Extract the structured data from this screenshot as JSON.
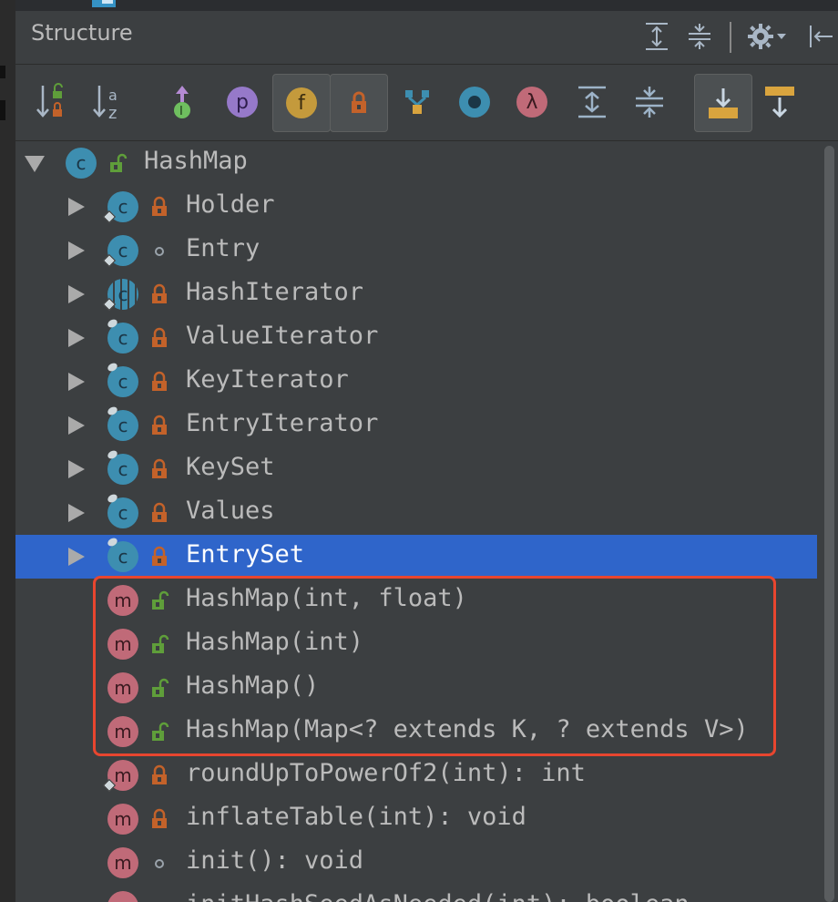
{
  "panel": {
    "title": "Structure"
  },
  "header_buttons": [
    {
      "name": "expand-all-icon"
    },
    {
      "name": "collapse-all-icon"
    },
    {
      "name": "gear-icon"
    },
    {
      "name": "hide-panel-icon"
    }
  ],
  "toolbar": [
    {
      "name": "sort-by-visibility-icon",
      "active": false
    },
    {
      "name": "sort-alphabetically-icon",
      "active": false
    },
    {
      "name": "show-inherited-icon",
      "active": false
    },
    {
      "name": "show-properties-icon",
      "glyph": "p",
      "active": false
    },
    {
      "name": "show-fields-icon",
      "glyph": "f",
      "active": true
    },
    {
      "name": "show-non-public-icon",
      "active": true
    },
    {
      "name": "show-hierarchy-icon",
      "active": false
    },
    {
      "name": "show-anonymous-icon",
      "active": false
    },
    {
      "name": "show-lambdas-icon",
      "glyph": "λ",
      "active": false
    },
    {
      "name": "expand-icon",
      "active": false
    },
    {
      "name": "collapse-icon",
      "active": false
    },
    {
      "name": "autoscroll-to-source-icon",
      "active": true
    },
    {
      "name": "autoscroll-from-source-icon",
      "active": false
    }
  ],
  "tree": [
    {
      "label": "HashMap",
      "kind": "class",
      "visibility": "public",
      "depth": 0,
      "expanded": true
    },
    {
      "label": "Holder",
      "kind": "class",
      "visibility": "private",
      "depth": 1,
      "expanded": false
    },
    {
      "label": "Entry",
      "kind": "class",
      "visibility": "package",
      "depth": 1,
      "expanded": false
    },
    {
      "label": "HashIterator",
      "kind": "abstract-class",
      "visibility": "private",
      "depth": 1,
      "expanded": false
    },
    {
      "label": "ValueIterator",
      "kind": "class",
      "visibility": "private",
      "depth": 1,
      "expanded": false
    },
    {
      "label": "KeyIterator",
      "kind": "class",
      "visibility": "private",
      "depth": 1,
      "expanded": false
    },
    {
      "label": "EntryIterator",
      "kind": "class",
      "visibility": "private",
      "depth": 1,
      "expanded": false
    },
    {
      "label": "KeySet",
      "kind": "class",
      "visibility": "private",
      "depth": 1,
      "expanded": false
    },
    {
      "label": "Values",
      "kind": "class",
      "visibility": "private",
      "depth": 1,
      "expanded": false
    },
    {
      "label": "EntrySet",
      "kind": "class",
      "visibility": "private",
      "depth": 1,
      "expanded": false,
      "selected": true
    },
    {
      "label": "HashMap(int, float)",
      "kind": "method",
      "visibility": "public",
      "depth": 1
    },
    {
      "label": "HashMap(int)",
      "kind": "method",
      "visibility": "public",
      "depth": 1
    },
    {
      "label": "HashMap()",
      "kind": "method",
      "visibility": "public",
      "depth": 1
    },
    {
      "label": "HashMap(Map<? extends K, ? extends V>)",
      "kind": "method",
      "visibility": "public",
      "depth": 1
    },
    {
      "label": "roundUpToPowerOf2(int): int",
      "kind": "method",
      "visibility": "private",
      "depth": 1
    },
    {
      "label": "inflateTable(int): void",
      "kind": "method",
      "visibility": "private",
      "depth": 1
    },
    {
      "label": "init(): void",
      "kind": "method",
      "visibility": "package",
      "depth": 1
    },
    {
      "label": "initHashSeedAsNeeded(int): boolean",
      "kind": "method",
      "visibility": "package",
      "depth": 1
    }
  ],
  "colors": {
    "selection": "#2f65ca",
    "highlight_box": "#e8462f",
    "class_icon": "#3d8eb0",
    "method_icon": "#c06a78",
    "private_lock": "#c3622a",
    "public_lock": "#5f9e3a"
  }
}
